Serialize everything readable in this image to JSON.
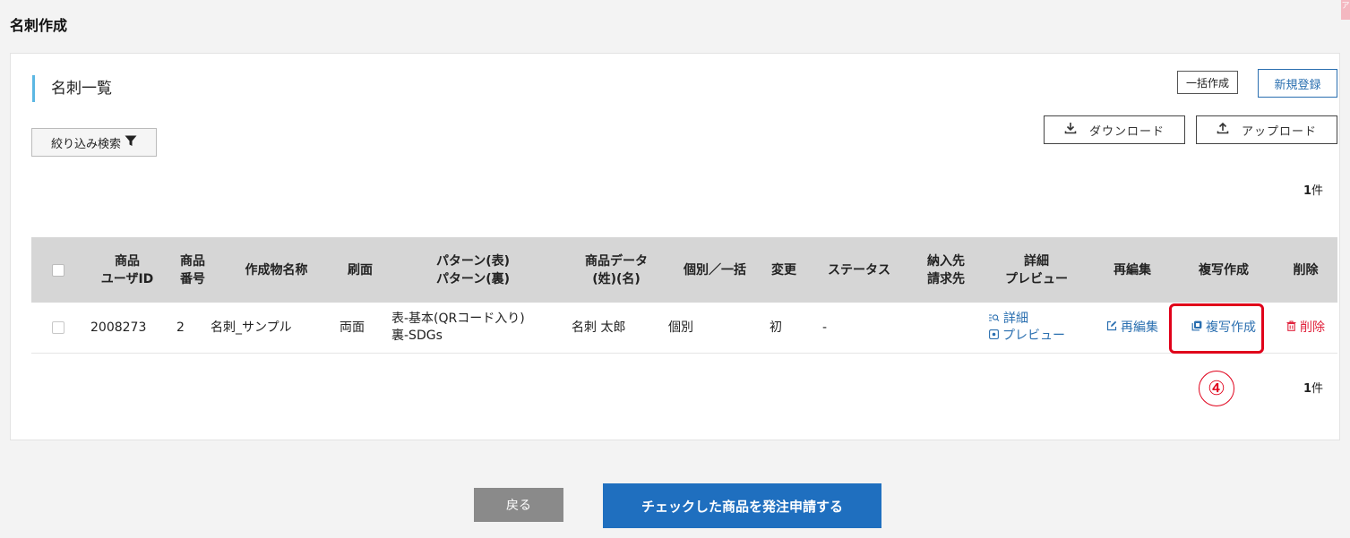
{
  "page": {
    "title": "名刺作成",
    "corner_mark": "ア"
  },
  "section": {
    "title": "名刺一覧"
  },
  "actions": {
    "bulk_create": "一括作成",
    "new_register": "新規登録",
    "download": "ダウンロード",
    "upload": "アップロード",
    "filter": "絞り込み検索"
  },
  "count": {
    "value": "1",
    "unit": "件"
  },
  "table": {
    "headers": {
      "user_id": [
        "商品",
        "ユーザID"
      ],
      "item_no": [
        "商品",
        "番号"
      ],
      "name": "作成物名称",
      "print_side": "刷面",
      "pattern": [
        "パターン(表)",
        "パターン(裏)"
      ],
      "item_data": [
        "商品データ",
        "(姓)(名)"
      ],
      "individual_bulk": "個別／一括",
      "change": "変更",
      "status": "ステータス",
      "delivery": [
        "納入先",
        "請求先"
      ],
      "detail_preview": [
        "詳細",
        "プレビュー"
      ],
      "reedit": "再編集",
      "copy_create": "複写作成",
      "delete": "削除"
    },
    "rows": [
      {
        "user_id": "2008273",
        "item_no": "2",
        "name": "名刺_サンプル",
        "print_side": "両面",
        "pattern_front": "表-基本(QRコード入り)",
        "pattern_back": "裏-SDGs",
        "item_data": "名刺 太郎",
        "individual_bulk": "個別",
        "change": "初",
        "status": "-",
        "delivery": "",
        "detail_link": "詳細",
        "preview_link": "プレビュー",
        "reedit_link": "再編集",
        "copy_link": "複写作成",
        "delete_link": "削除"
      }
    ]
  },
  "annotation": {
    "step_marker": "④",
    "highlight_color": "#e0001a"
  },
  "footer": {
    "back": "戻る",
    "submit": "チェックした商品を発注申請する"
  },
  "colors": {
    "accent_blue": "#1f6fbf",
    "section_bar": "#5bb7e3",
    "delete_red": "#e0223c",
    "header_gray": "#d6d6d6"
  }
}
